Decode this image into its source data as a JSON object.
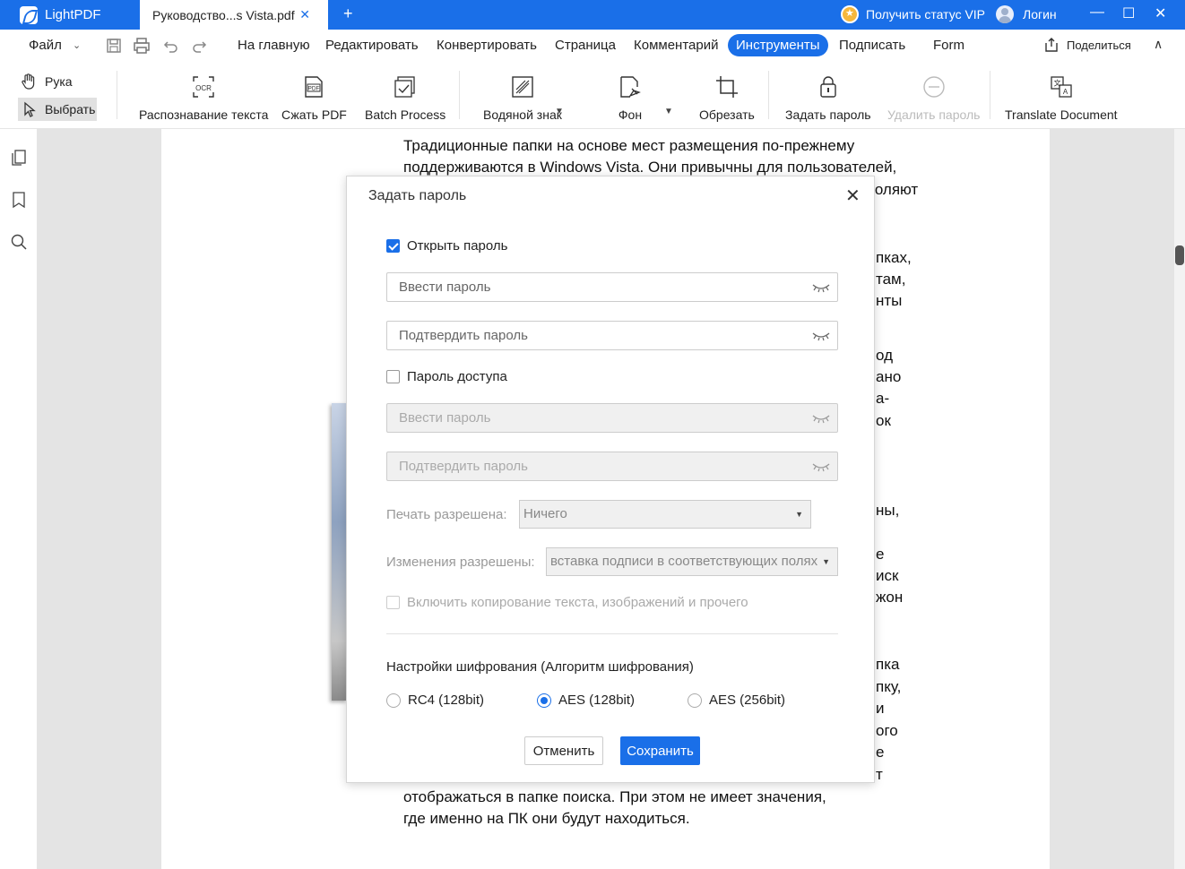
{
  "titlebar": {
    "app_name": "LightPDF",
    "doc_tab": "Руководство...s Vista.pdf",
    "new_tab": "+",
    "vip": "Получить статус VIP",
    "login": "Логин",
    "minimize": "—",
    "maximize": "☐",
    "close": "✕"
  },
  "menubar": {
    "file": "Файл",
    "items": [
      "На главную",
      "Редактировать",
      "Конвертировать",
      "Страница",
      "Комментарий",
      "Инструменты",
      "Подписать",
      "Form"
    ],
    "active": "Инструменты",
    "share": "Поделиться"
  },
  "toolbar": {
    "hand": "Рука",
    "select": "Выбрать",
    "tools": [
      "Распознавание текста",
      "Сжать PDF",
      "Batch Process",
      "Водяной знак",
      "Фон",
      "Обрезать",
      "Задать пароль",
      "Удалить пароль",
      "Translate Document"
    ]
  },
  "document": {
    "lines_top": [
      "Традиционные папки на основе мест размещения по-прежнему",
      "поддерживаются в Windows Vista. Они привычны для пользователей,"
    ],
    "line3_tail": "воляют",
    "right_fragments": [
      "пках,",
      "там,",
      "нты",
      "од",
      "ано",
      "а-",
      "ок",
      "ны,",
      "е",
      "иск",
      "жон",
      "пка",
      "пку,",
      "и",
      "ого",
      "е",
      "т"
    ],
    "lines_bottom": [
      "отображаться в папке поиска. При этом не имеет значения,",
      "где именно на ПК они будут находиться."
    ]
  },
  "dialog": {
    "title": "Задать пароль",
    "open_password": {
      "label": "Открыть пароль",
      "checked": true,
      "enter_placeholder": "Ввести пароль",
      "confirm_placeholder": "Подтвердить пароль"
    },
    "access_password": {
      "label": "Пароль доступа",
      "checked": false,
      "enter_placeholder": "Ввести пароль",
      "confirm_placeholder": "Подтвердить пароль"
    },
    "print_label": "Печать разрешена:",
    "print_value": "Ничего",
    "changes_label": "Изменения разрешены:",
    "changes_value": "вставка подписи в соответствующих полях",
    "copy_label": "Включить копирование текста, изображений и прочего",
    "encryption_title": "Настройки шифрования (Алгоритм шифрования)",
    "encryption_options": [
      "RC4 (128bit)",
      "AES (128bit)",
      "AES (256bit)"
    ],
    "encryption_selected": "AES (128bit)",
    "cancel": "Отменить",
    "save": "Сохранить"
  },
  "colors": {
    "accent": "#1a6fe8",
    "doc_bg": "#e4e4e4"
  }
}
